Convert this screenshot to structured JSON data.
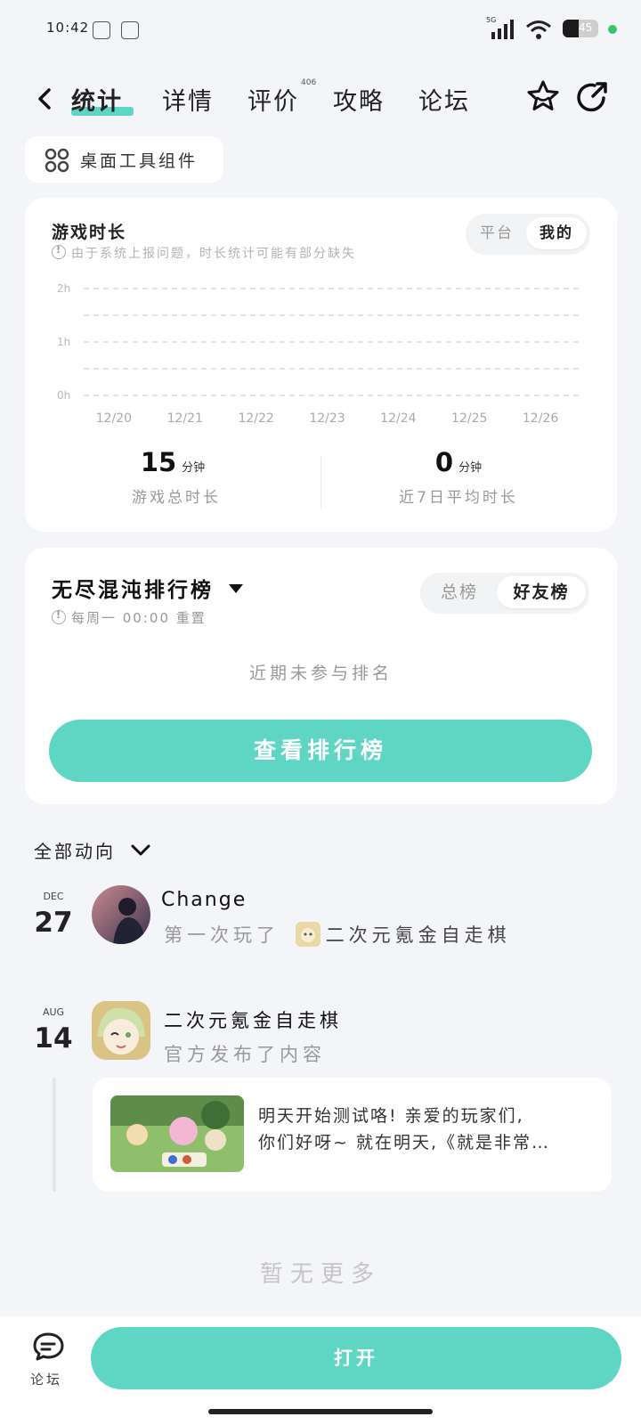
{
  "status_bar": {
    "time": "10:42",
    "network": "5G",
    "battery": "45"
  },
  "header": {
    "back_icon": "chevron-left-icon",
    "tabs": [
      {
        "label": "统计",
        "active": true
      },
      {
        "label": "详情",
        "active": false
      },
      {
        "label": "评价",
        "badge": "406",
        "active": false
      },
      {
        "label": "攻略",
        "active": false
      },
      {
        "label": "论坛",
        "active": false
      }
    ],
    "favorite_icon": "star-icon",
    "share_icon": "share-icon"
  },
  "widget_chip": {
    "icon": "grid-icon",
    "label": "桌面工具组件"
  },
  "playtime": {
    "title": "游戏时长",
    "note": "由于系统上报问题，时长统计可能有部分缺失",
    "toggle": [
      "平台",
      "我的"
    ],
    "toggle_selected": "我的",
    "total_value": "15",
    "total_unit": "分钟",
    "total_label": "游戏总时长",
    "avg_value": "0",
    "avg_unit": "分钟",
    "avg_label": "近7日平均时长"
  },
  "chart_data": {
    "type": "bar",
    "categories": [
      "12/20",
      "12/21",
      "12/22",
      "12/23",
      "12/24",
      "12/25",
      "12/26"
    ],
    "values": [
      0,
      0,
      0,
      0,
      0,
      0,
      0
    ],
    "y_ticks": [
      "2h",
      "1h",
      "0h"
    ],
    "ylim": [
      0,
      2
    ],
    "grid": true
  },
  "leaderboard": {
    "title": "无尽混沌排行榜",
    "note": "每周一 00:00 重置",
    "toggle": [
      "总榜",
      "好友榜"
    ],
    "toggle_selected": "好友榜",
    "empty_text": "近期未参与排名",
    "button_label": "查看排行榜"
  },
  "feed": {
    "filter_label": "全部动向",
    "items": [
      {
        "month": "DEC",
        "day": "27",
        "name": "Change",
        "desc_prefix": "第一次玩了",
        "desc_game": "二次元氪金自走棋"
      },
      {
        "month": "AUG",
        "day": "14",
        "name": "二次元氪金自走棋",
        "desc": "官方发布了内容",
        "post_line1": "明天开始测试咯! 亲爱的玩家们,",
        "post_line2": "你们好呀~ 就在明天,《就是非常…"
      }
    ],
    "end_text": "暂无更多"
  },
  "bottom_bar": {
    "forum_label": "论坛",
    "open_label": "打开"
  },
  "colors": {
    "accent": "#5fd5c4",
    "background": "#f3f5f8"
  }
}
